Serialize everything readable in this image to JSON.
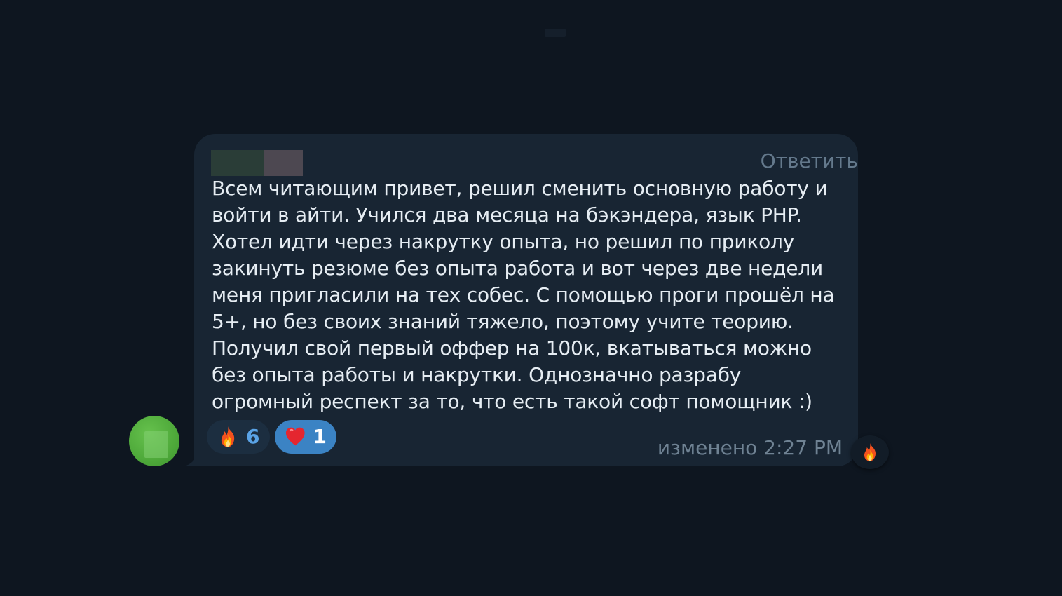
{
  "chat": {
    "reply_label": "Ответить",
    "message_text": "Всем читающим привет, решил сменить основную работу и войти в айти. Учился два месяца на бэкэндера, язык PHP. Хотел идти через накрутку опыта, но решил по приколу закинуть резюме без опыта работа и вот через две недели меня пригласили на тех собес. С помощью проги прошёл на 5+, но без своих знаний тяжело, поэтому учите теорию. Получил свой первый оффер на 100к, вкатываться можно без опыта работы и накрутки. Однозначно разрабу огромный респект за то, что есть такой софт помощник :)",
    "meta": "изменено 2:27 PM",
    "reactions": [
      {
        "icon": "fire-icon",
        "count": "6",
        "color": "#1c2e40"
      },
      {
        "icon": "heart-icon",
        "count": "1",
        "color": "#3b83c4"
      }
    ],
    "quick_reaction_icon": "fire-icon"
  },
  "colors": {
    "background": "#0e1620",
    "bubble": "#182533",
    "text": "#e6edf3",
    "muted": "#6f8293",
    "accent": "#5aa3e6",
    "avatar": "#4ea93a"
  }
}
